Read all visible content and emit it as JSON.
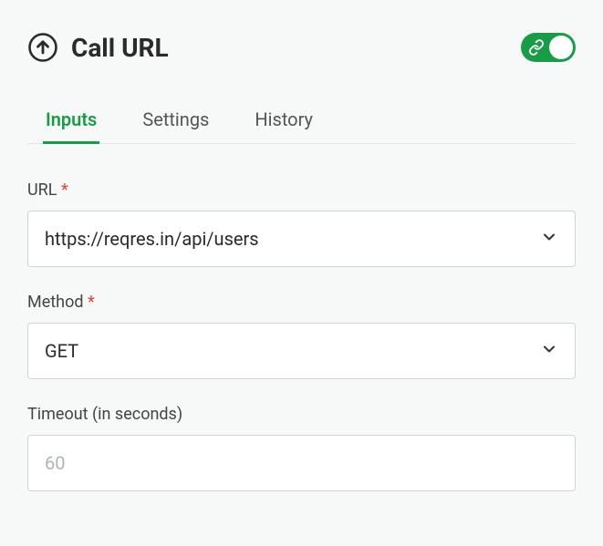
{
  "header": {
    "title": "Call URL"
  },
  "tabs": {
    "inputs": "Inputs",
    "settings": "Settings",
    "history": "History"
  },
  "form": {
    "url": {
      "label": "URL",
      "required": "*",
      "value": "https://reqres.in/api/users"
    },
    "method": {
      "label": "Method",
      "required": "*",
      "value": "GET"
    },
    "timeout": {
      "label": "Timeout (in seconds)",
      "placeholder": "60",
      "value": ""
    }
  }
}
